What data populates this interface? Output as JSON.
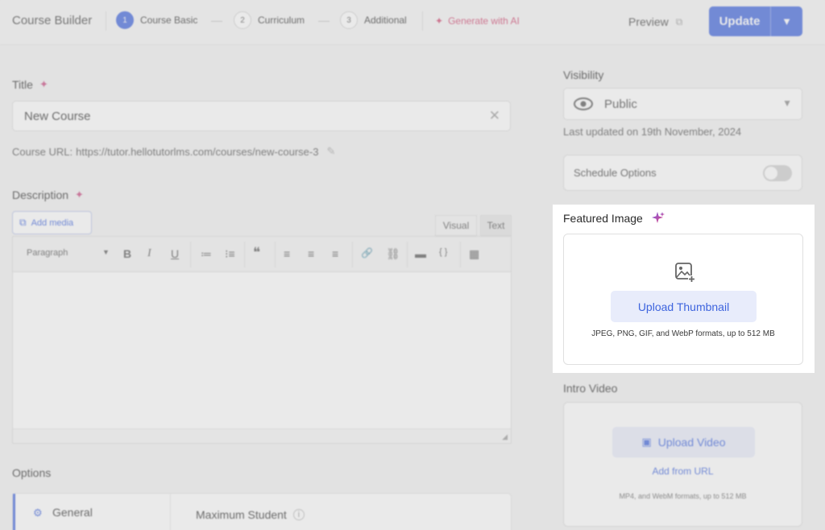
{
  "header": {
    "brand": "Course Builder",
    "steps": [
      {
        "num": "1",
        "label": "Course Basic"
      },
      {
        "num": "2",
        "label": "Curriculum"
      },
      {
        "num": "3",
        "label": "Additional"
      }
    ],
    "generate_ai": "Generate with AI",
    "preview": "Preview",
    "update": "Update"
  },
  "title": {
    "label": "Title",
    "value": "New Course",
    "course_url_label": "Course URL:",
    "course_url": "https://tutor.hellotutorlms.com/courses/new-course-3"
  },
  "description": {
    "label": "Description",
    "add_media": "Add media",
    "tabs": [
      "Visual",
      "Text"
    ],
    "format_select": "Paragraph",
    "toolbar": [
      "B",
      "I",
      "U",
      "≔",
      "⁝≡",
      "❝",
      "≡",
      "≡",
      "≡",
      "🔗",
      "⛓",
      "▬",
      "{ }",
      "▦"
    ]
  },
  "options": {
    "label": "Options",
    "tab_general": "General",
    "max_student": "Maximum Student"
  },
  "visibility": {
    "label": "Visibility",
    "value": "Public",
    "last_updated": "Last updated on 19th November, 2024",
    "schedule_options": "Schedule Options"
  },
  "featured_image": {
    "label": "Featured Image",
    "upload_button": "Upload Thumbnail",
    "formats": "JPEG, PNG, GIF, and WebP formats, up to 512 MB"
  },
  "intro_video": {
    "label": "Intro Video",
    "upload_button": "Upload Video",
    "add_from_url": "Add from URL",
    "formats": "MP4, and WebM formats, up to 512 MB"
  },
  "colors": {
    "accent": "#3e64de",
    "ai_pink": "#d0456f"
  }
}
